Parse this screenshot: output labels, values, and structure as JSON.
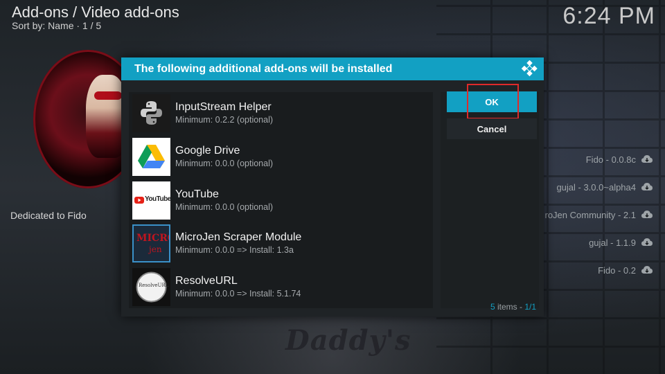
{
  "header": {
    "title": "Add-ons / Video add-ons",
    "subtitle": "Sort by: Name  ·  1 / 5",
    "clock": "6:24 PM"
  },
  "background": {
    "dedicated_text": "Dedicated to Fido",
    "banner_text": "Daddy's",
    "repo_items": [
      {
        "label": "Fido - 0.0.8c"
      },
      {
        "label": "gujal - 3.0.0~alpha4"
      },
      {
        "label": "roJen Community - 2.1"
      },
      {
        "label": "gujal - 1.1.9"
      },
      {
        "label": "Fido - 0.2"
      }
    ]
  },
  "dialog": {
    "title": "The following additional add-ons will be installed",
    "accent_color": "#12a0c3",
    "items": [
      {
        "name": "InputStream Helper",
        "detail": "Minimum: 0.2.2 (optional)",
        "icon": "python-icon"
      },
      {
        "name": "Google Drive",
        "detail": "Minimum: 0.0.0 (optional)",
        "icon": "google-drive-icon"
      },
      {
        "name": "YouTube",
        "detail": "Minimum: 0.0.0 (optional)",
        "icon": "youtube-icon"
      },
      {
        "name": "MicroJen Scraper Module",
        "detail": "Minimum: 0.0.0 => Install: 1.3a",
        "icon": "microjen-icon"
      },
      {
        "name": "ResolveURL",
        "detail": "Minimum: 0.0.0 => Install: 5.1.74",
        "icon": "resolveurl-icon"
      }
    ],
    "ok_label": "OK",
    "cancel_label": "Cancel",
    "items_count": "5",
    "items_word": " items - ",
    "page": "1/1",
    "python_label": "python",
    "youtube_label": "YouTube",
    "microjen_label_1": "MICRO",
    "microjen_label_2": "jen",
    "resolve_label": "ResolveURL"
  }
}
